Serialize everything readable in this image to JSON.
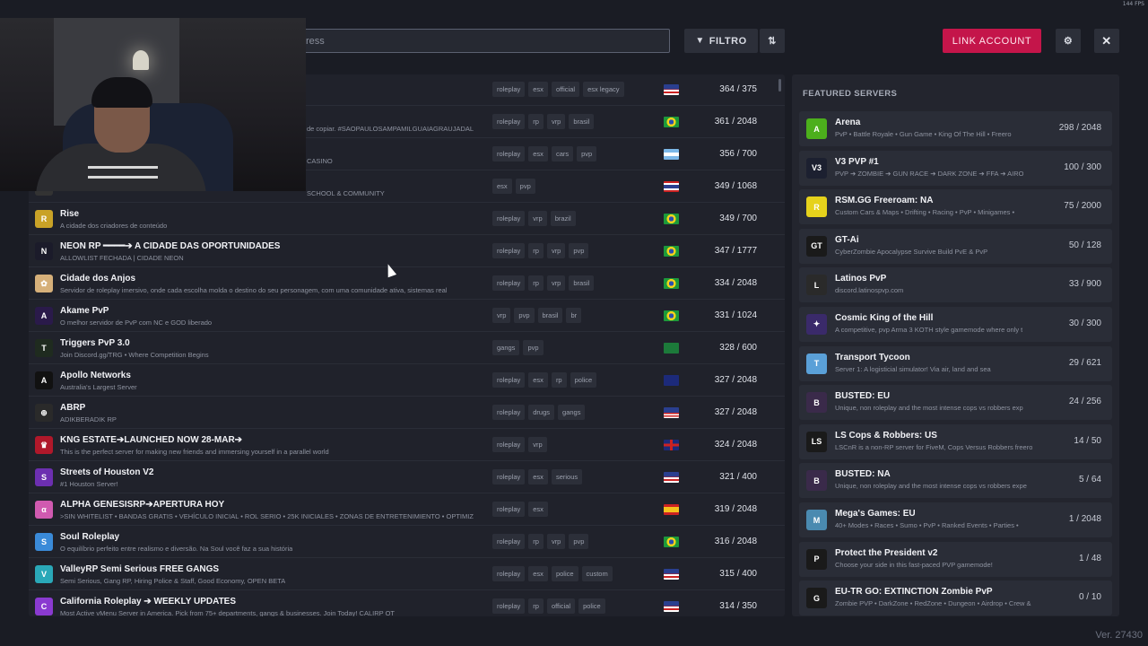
{
  "fps": "144 FPS",
  "search": {
    "value": "ress"
  },
  "toolbar": {
    "filter_label": "FILTRO",
    "filter_icon": "funnel-icon",
    "sort_icon": "sort-icon",
    "link_label": "LINK ACCOUNT",
    "gear_icon": "gear-icon",
    "close_label": "✕"
  },
  "servers": [
    {
      "name": "",
      "desc": "",
      "tags": [
        "roleplay",
        "esx",
        "official",
        "esx legacy"
      ],
      "flag": "us",
      "players": "364 / 375",
      "icon_color": "#333",
      "icon_text": ""
    },
    {
      "name": "",
      "desc": "de copiar. #SAOPAULOSAMPAMILGUAIAGRAUJADAL",
      "tags": [
        "roleplay",
        "rp",
        "vrp",
        "brasil"
      ],
      "flag": "br",
      "players": "361 / 2048",
      "icon_color": "#333",
      "icon_text": ""
    },
    {
      "name": "",
      "desc": "CASINO",
      "tags": [
        "roleplay",
        "esx",
        "cars",
        "pvp"
      ],
      "flag": "ar",
      "players": "356 / 700",
      "icon_color": "#333",
      "icon_text": ""
    },
    {
      "name": "",
      "desc": "SCHOOL & COMMUNITY",
      "tags": [
        "esx",
        "pvp"
      ],
      "flag": "th",
      "players": "349 / 1068",
      "icon_color": "#333",
      "icon_text": ""
    },
    {
      "name": "Rise",
      "desc": "A cidade dos criadores de conteúdo",
      "tags": [
        "roleplay",
        "vrp",
        "brazil"
      ],
      "flag": "br",
      "players": "349 / 700",
      "icon_color": "#c9a227",
      "icon_text": "R"
    },
    {
      "name": "NEON RP ━━━━➔ A CIDADE DAS OPORTUNIDADES",
      "desc": "ALLOWLIST FECHADA  |  CIDADE NEON",
      "tags": [
        "roleplay",
        "rp",
        "vrp",
        "pvp"
      ],
      "flag": "br",
      "players": "347 / 1777",
      "icon_color": "#1b1b2a",
      "icon_text": "N"
    },
    {
      "name": "Cidade dos Anjos",
      "desc": "Servidor de roleplay imersivo, onde cada escolha molda o destino do seu personagem, com uma comunidade ativa, sistemas real",
      "tags": [
        "roleplay",
        "rp",
        "vrp",
        "brasil"
      ],
      "flag": "br",
      "players": "334 / 2048",
      "icon_color": "#d6b07a",
      "icon_text": "✿"
    },
    {
      "name": "Akame PvP",
      "desc": "O melhor servidor de PvP com NC e GOD liberado",
      "tags": [
        "vrp",
        "pvp",
        "brasil",
        "br"
      ],
      "flag": "br",
      "players": "331 / 1024",
      "icon_color": "#2a1a4a",
      "icon_text": "A"
    },
    {
      "name": "Triggers PvP 3.0",
      "desc": "Join Discord.gg/TRG • Where Competition Begins",
      "tags": [
        "gangs",
        "pvp"
      ],
      "flag": "sa",
      "players": "328 / 600",
      "icon_color": "#1f2b1f",
      "icon_text": "T"
    },
    {
      "name": "Apollo Networks",
      "desc": "Australia's Largest Server",
      "tags": [
        "roleplay",
        "esx",
        "rp",
        "police"
      ],
      "flag": "au",
      "players": "327 / 2048",
      "icon_color": "#111",
      "icon_text": "A"
    },
    {
      "name": "ABRP",
      "desc": "ADIKBERADIK RP",
      "tags": [
        "roleplay",
        "drugs",
        "gangs"
      ],
      "flag": "my",
      "players": "327 / 2048",
      "icon_color": "#2a2a2a",
      "icon_text": "⊕"
    },
    {
      "name": "KNG ESTATE➔LAUNCHED NOW 28-MAR➔",
      "desc": "This is the perfect server for making new friends and immersing yourself in a parallel world",
      "tags": [
        "roleplay",
        "vrp"
      ],
      "flag": "gb",
      "players": "324 / 2048",
      "icon_color": "#b0182a",
      "icon_text": "♛"
    },
    {
      "name": "Streets of Houston V2",
      "desc": "#1 Houston Server!",
      "tags": [
        "roleplay",
        "esx",
        "serious"
      ],
      "flag": "us",
      "players": "321 / 400",
      "icon_color": "#6c2fb0",
      "icon_text": "S"
    },
    {
      "name": "ALPHA GENESISRP➔APERTURA HOY",
      "desc": ">SIN WHITELIST • BANDAS GRATIS • VEHÍCULO INICIAL • ROL SERIO • 25K INICIALES • ZONAS DE ENTRETENIMIENTO • OPTIMIZ",
      "tags": [
        "roleplay",
        "esx"
      ],
      "flag": "es",
      "players": "319 / 2048",
      "icon_color": "#d05ab0",
      "icon_text": "α"
    },
    {
      "name": "Soul Roleplay",
      "desc": "O equilíbrio perfeito entre realismo e diversão. Na Soul você faz a sua história",
      "tags": [
        "roleplay",
        "rp",
        "vrp",
        "pvp"
      ],
      "flag": "br",
      "players": "316 / 2048",
      "icon_color": "#3a8ad8",
      "icon_text": "S"
    },
    {
      "name": "ValleyRP Semi Serious FREE GANGS",
      "desc": "Semi Serious, Gang RP, Hiring Police & Staff, Good Economy, OPEN BETA",
      "tags": [
        "roleplay",
        "esx",
        "police",
        "custom"
      ],
      "flag": "us",
      "players": "315 / 400",
      "icon_color": "#2aa8b8",
      "icon_text": "V"
    },
    {
      "name": "California Roleplay ➔ WEEKLY UPDATES",
      "desc": "Most Active vMenu Server in America. Pick from 75+ departments, gangs & businesses. Join Today! CALIRP OT",
      "tags": [
        "roleplay",
        "rp",
        "official",
        "police"
      ],
      "flag": "us",
      "players": "314 / 350",
      "icon_color": "#8a3ad0",
      "icon_text": "C"
    }
  ],
  "featured": {
    "title": "FEATURED SERVERS",
    "items": [
      {
        "name": "Arena",
        "desc": "PvP • Battle Royale • Gun Game • King Of The Hill • Freero",
        "players": "298 / 2048",
        "icon_color": "#4caf1c",
        "icon_text": "A"
      },
      {
        "name": "V3 PVP #1",
        "desc": "PVP ➔ ZOMBIE ➔ GUN RACE ➔ DARK ZONE ➔ FFA ➔ AIRO",
        "players": "100 / 300",
        "icon_color": "#1c2030",
        "icon_text": "V3"
      },
      {
        "name": "RSM.GG Freeroam: NA",
        "desc": "Custom Cars & Maps • Drifting • Racing • PvP • Minigames •",
        "players": "75 / 2000",
        "icon_color": "#e6d21c",
        "icon_text": "R"
      },
      {
        "name": "GT-Ai",
        "desc": "CyberZombie Apocalypse Survive Build PvE & PvP",
        "players": "50 / 128",
        "icon_color": "#1a1a1a",
        "icon_text": "GT"
      },
      {
        "name": "Latinos PvP",
        "desc": "discord.latinospvp.com",
        "players": "33 / 900",
        "icon_color": "#2a2a2a",
        "icon_text": "L"
      },
      {
        "name": "Cosmic King of the Hill",
        "desc": "A competitive, pvp Arma 3 KOTH style gamemode where only t",
        "players": "30 / 300",
        "icon_color": "#3a2a6a",
        "icon_text": "✦"
      },
      {
        "name": "Transport Tycoon",
        "desc": "Server 1: A logisticial simulator! Via air, land and sea",
        "players": "29 / 621",
        "icon_color": "#5aa0d8",
        "icon_text": "T"
      },
      {
        "name": "BUSTED: EU",
        "desc": "Unique, non roleplay and the most intense cops vs robbers exp",
        "players": "24 / 256",
        "icon_color": "#3a2a4a",
        "icon_text": "B"
      },
      {
        "name": "LS Cops & Robbers: US",
        "desc": "LSCnR is a non-RP server for FiveM, Cops Versus Robbers freero",
        "players": "14 / 50",
        "icon_color": "#1a1a1a",
        "icon_text": "LS"
      },
      {
        "name": "BUSTED: NA",
        "desc": "Unique, non roleplay and the most intense cops vs robbers expe",
        "players": "5 / 64",
        "icon_color": "#3a2a4a",
        "icon_text": "B"
      },
      {
        "name": "Mega's Games: EU",
        "desc": "40+ Modes • Races • Sumo • PvP • Ranked Events • Parties •",
        "players": "1 / 2048",
        "icon_color": "#4a8ab0",
        "icon_text": "M"
      },
      {
        "name": "Protect the President v2",
        "desc": "Choose your side in this fast-paced PVP gamemode!",
        "players": "1 / 48",
        "icon_color": "#1a1a1a",
        "icon_text": "P"
      },
      {
        "name": "EU-TR GO: EXTINCTION Zombie PvP",
        "desc": "Zombie PVP • DarkZone • RedZone • Dungeon • Airdrop • Crew & S",
        "players": "0 / 10",
        "icon_color": "#1a1a1a",
        "icon_text": "G"
      }
    ]
  },
  "version": "Ver. 27430"
}
